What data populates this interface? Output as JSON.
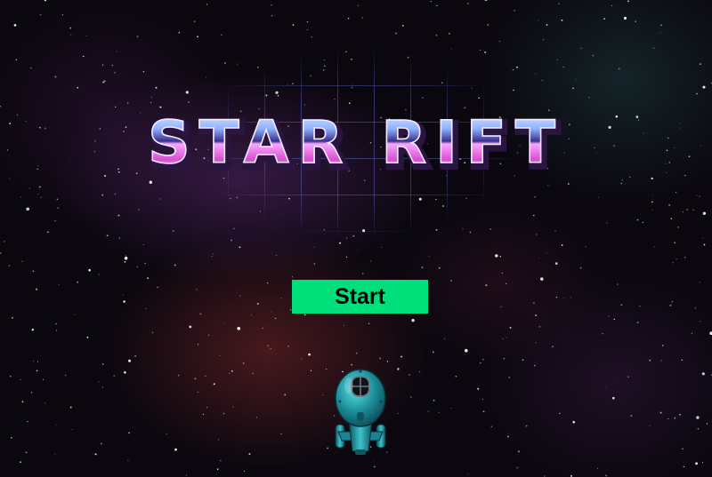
{
  "game": {
    "title": "STAR RIFT",
    "start_label": "Start"
  },
  "colors": {
    "start_button_bg": "#00e07a",
    "grid_line": "#5a64c8",
    "title_chrome_top": "#a7c8ff",
    "title_chrome_bottom": "#e24bd0",
    "ship_body": "#1c8f9a"
  },
  "icons": {
    "ship": "spaceship-icon"
  }
}
